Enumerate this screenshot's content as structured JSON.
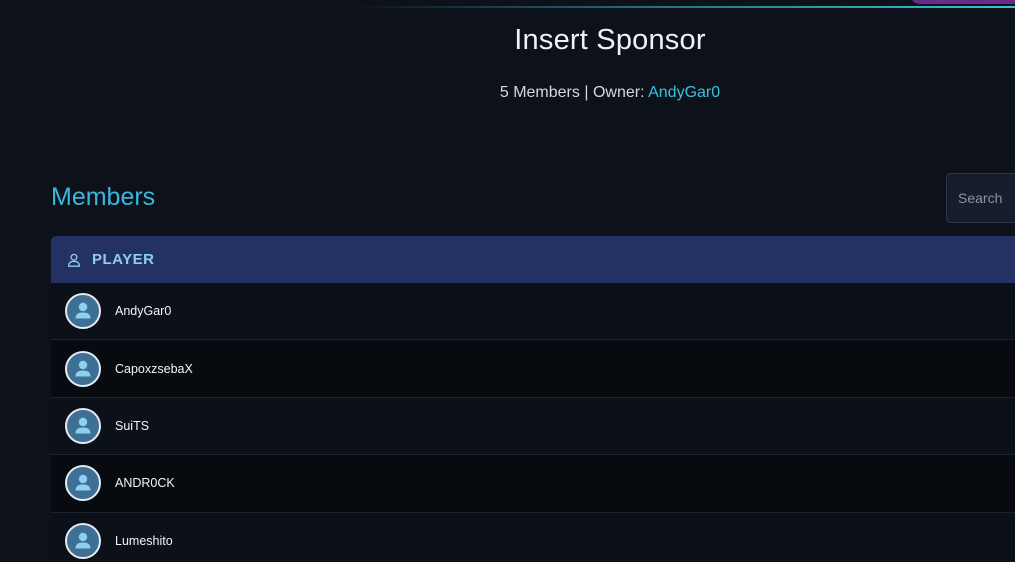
{
  "team": {
    "title": "Insert Sponsor",
    "member_count": "5 Members",
    "separator": "|",
    "owner_label": "Owner:",
    "owner_name": "AndyGar0"
  },
  "members_section": {
    "title": "Members",
    "search_placeholder": "Search"
  },
  "group": {
    "icon": "user-outline-icon",
    "label": "PLAYER"
  },
  "members": [
    {
      "name": "AndyGar0",
      "avatar_icon": "default-avatar-icon"
    },
    {
      "name": "CapoxzsebaX",
      "avatar_icon": "default-avatar-icon"
    },
    {
      "name": "SuiTS",
      "avatar_icon": "default-avatar-icon"
    },
    {
      "name": "ANDR0CK",
      "avatar_icon": "default-avatar-icon"
    },
    {
      "name": "Lumeshito",
      "avatar_icon": "default-avatar-icon"
    }
  ],
  "colors": {
    "background": "#0d111a",
    "accent": "#38b8dc",
    "group_header": "#233163",
    "avatar": "#3e6f94"
  }
}
